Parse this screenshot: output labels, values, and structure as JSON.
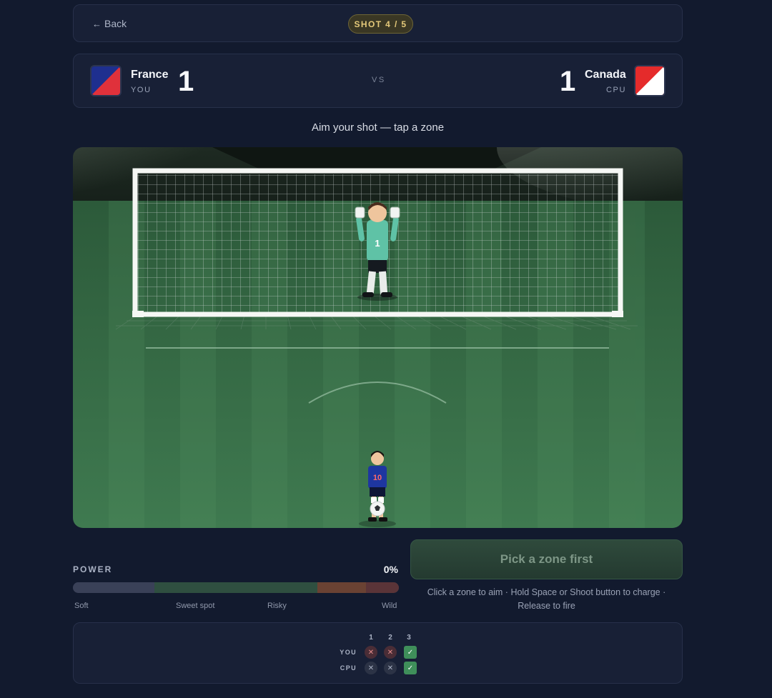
{
  "topbar": {
    "back_label": "Back",
    "back_icon": "arrow-left-icon",
    "shot_badge": "SHOT 4 / 5"
  },
  "match": {
    "home": {
      "name": "France",
      "role": "YOU",
      "score": "1",
      "flag_colors": [
        "#1e2f8f",
        "#e0313b"
      ]
    },
    "away": {
      "name": "Canada",
      "role": "CPU",
      "score": "1",
      "flag_colors": [
        "#ffffff",
        "#e52b2b"
      ]
    },
    "vs_label": "VS"
  },
  "instruction": "Aim your shot — tap a zone",
  "pitch": {
    "keeper_number": "1",
    "shooter_number": "10"
  },
  "power": {
    "label": "POWER",
    "value_text": "0%",
    "value": 0,
    "zones": [
      {
        "name": "Soft",
        "fraction": 0.25,
        "color": "#3a4158"
      },
      {
        "name": "Sweet spot",
        "fraction": 0.5,
        "color": "#2f4f40"
      },
      {
        "name": "Risky",
        "fraction": 0.15,
        "color": "#6a4233"
      },
      {
        "name": "Wild",
        "fraction": 0.1,
        "color": "#5a3438"
      }
    ],
    "ticks": [
      "Soft",
      "Sweet spot",
      "Risky",
      "Wild"
    ]
  },
  "shoot_button": {
    "label": "Pick a zone first",
    "enabled": false
  },
  "help_text_1": "Click a zone to aim · Hold Space or Shoot button to charge ·",
  "help_text_2": "Release to fire",
  "scoreboard": {
    "columns": [
      "1",
      "2",
      "3"
    ],
    "rows": [
      {
        "label": "YOU",
        "results": [
          "miss",
          "miss",
          "goal"
        ]
      },
      {
        "label": "CPU",
        "results": [
          "save",
          "save",
          "goal"
        ]
      }
    ],
    "miss_symbol": "✕",
    "goal_symbol": "✓"
  },
  "colors": {
    "background": "#121a2e",
    "card": "#182036",
    "accent_gold": "#e4c97a",
    "goal_green": "#3f8f5a"
  }
}
